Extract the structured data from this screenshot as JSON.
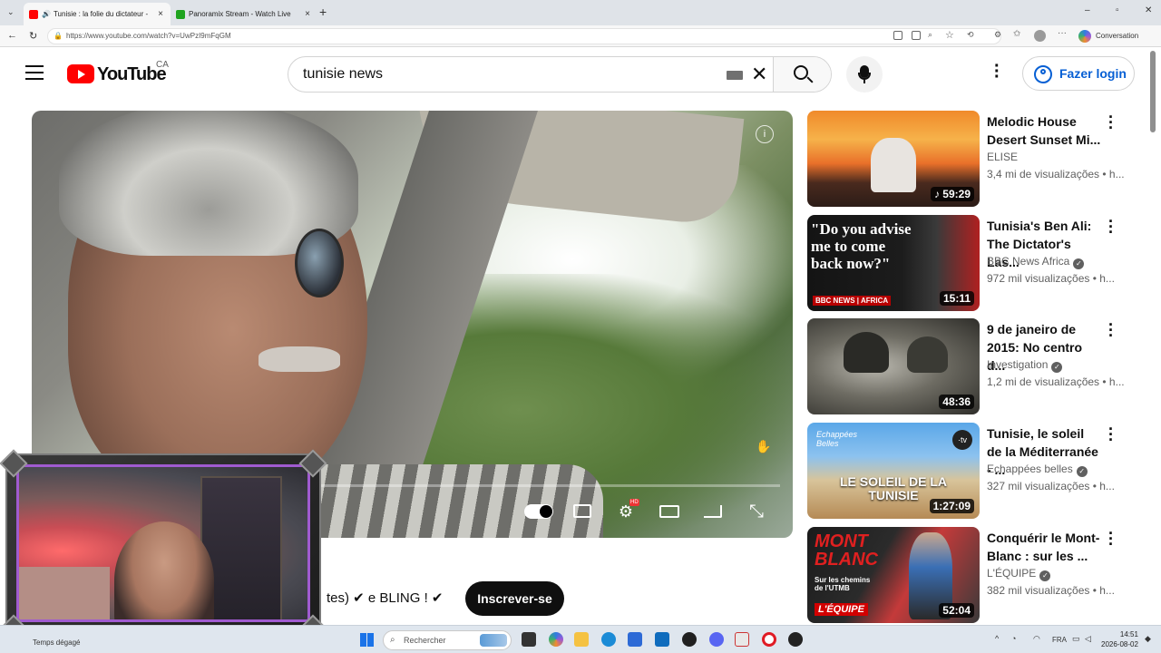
{
  "browser": {
    "tabs": [
      {
        "title": "Tunisie : la folie du dictateur -",
        "color": "#ff0000"
      },
      {
        "title": "Panoramix Stream - Watch Live",
        "color": "#1fa31f"
      }
    ],
    "url": "https://www.youtube.com/watch?v=UwPzI9mFqGM",
    "copilot_label": "Conversation"
  },
  "header": {
    "logo_text": "YouTube",
    "region": "CA",
    "search_value": "tunisie news",
    "login_label": "Fazer login"
  },
  "player": {
    "channel_line": "tes) ✔ e BLING ! ✔",
    "subscribe_label": "Inscrever-se"
  },
  "sidebar": [
    {
      "title": "Melodic House Desert Sunset Mi...",
      "channel": "ELISE",
      "verified": false,
      "views": "3,4 mi de visualizações • h...",
      "duration": "59:29",
      "music": true,
      "thumb": "linear-gradient(180deg,#f08a2a 0%,#f6b24a 30%,#e9702a 55%,#4a2a1e 75%,#2b1c17 100%)"
    },
    {
      "title": "Tunisia's Ben Ali: The Dictator's Las...",
      "channel": "BBC News Africa",
      "verified": true,
      "views": "972 mil visualizações • h...",
      "duration": "15:11",
      "music": false,
      "thumb": "linear-gradient(90deg,#141414 0%,#1c1c1c 55%,#3a3a3a 75%,#b02020 100%)",
      "overlay_text": "\"Do you advise me to come back now?\"",
      "badge": "BBC NEWS | AFRICA"
    },
    {
      "title": "9 de janeiro de 2015: No centro d...",
      "channel": "Investigation",
      "verified": true,
      "views": "1,2 mi de visualizações • h...",
      "duration": "48:36",
      "music": false,
      "thumb": "radial-gradient(ellipse at 40% 50%,#b9b7ae 0%,#6e6c63 45%,#2f2e2a 100%)"
    },
    {
      "title": "Tunisie, le soleil de la Méditerranée - ...",
      "channel": "Echappées belles",
      "verified": true,
      "views": "327 mil visualizações • h...",
      "duration": "1:27:09",
      "music": false,
      "thumb": "linear-gradient(180deg,#5aa7e8 0%,#8cc2ef 35%,#d8c49a 60%,#b58a55 100%)",
      "overlay_text": "LE SOLEIL DE LA TUNISIE",
      "badge": "Echappées Belles"
    },
    {
      "title": "Conquérir le Mont-Blanc : sur les ...",
      "channel": "L'ÉQUIPE",
      "verified": true,
      "views": "382 mil visualizações • h...",
      "duration": "52:04",
      "music": false,
      "thumb": "linear-gradient(120deg,#1b1b1b 0%,#2b2b2b 40%,#c43a3a 60%,#3a3a3a 100%)",
      "overlay_text": "MONT BLANC",
      "badge": "L'ÉQUIPE",
      "badge_sub": "Sur les chemins de l'UTMB"
    }
  ],
  "taskbar": {
    "search_placeholder": "Rechercher",
    "lang": "FRA",
    "time": "14:51",
    "date": "2026-08-02",
    "left_text": "Temps dégagé"
  }
}
